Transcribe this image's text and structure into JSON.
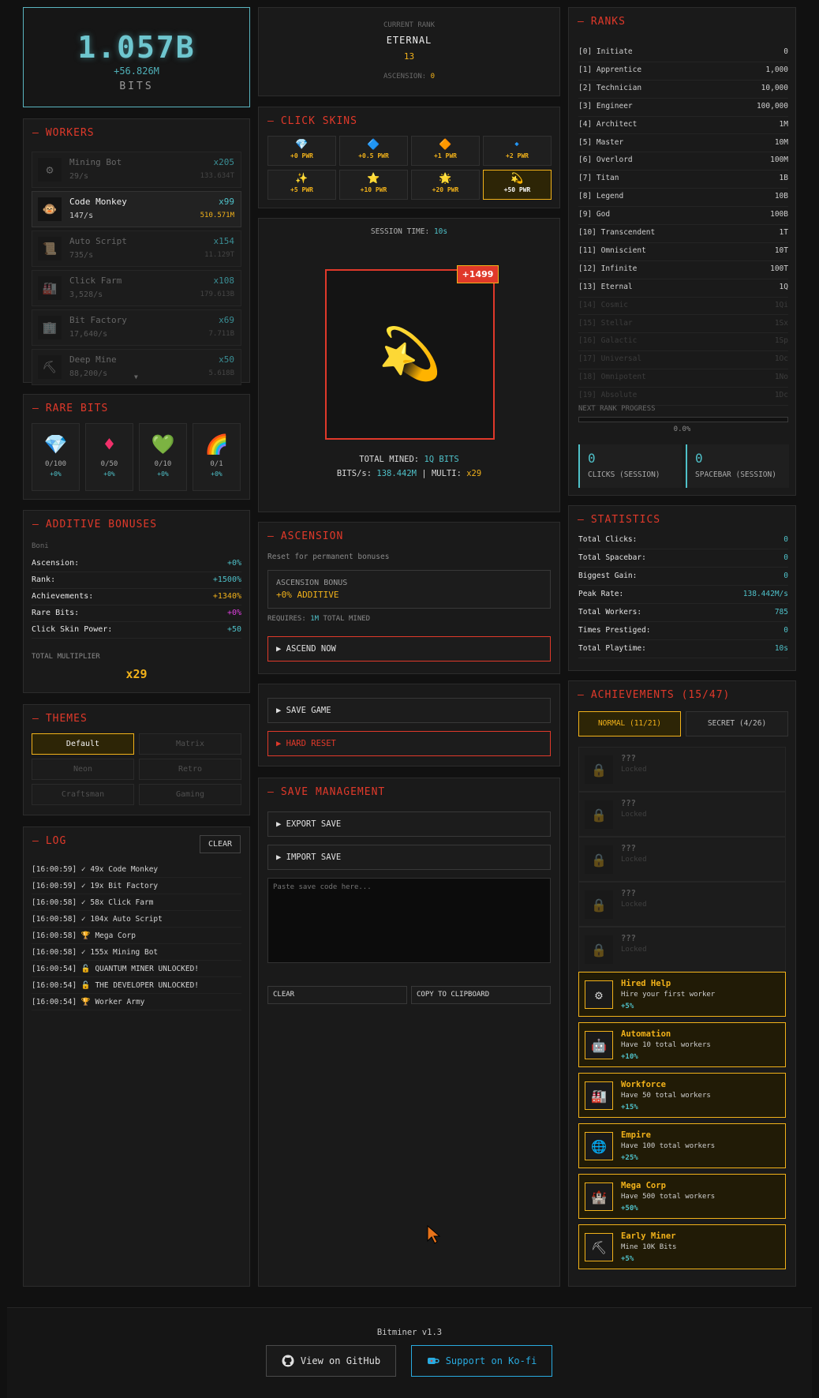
{
  "bits": {
    "value": "1.057B",
    "rate": "+56.826M",
    "unit": "BITS"
  },
  "workers": {
    "title": "WORKERS",
    "items": [
      {
        "name": "Mining Bot",
        "rate": "29/s",
        "count": "x205",
        "cost": "133.634T",
        "icon": "gear-icon",
        "glyph": "⚙",
        "active": false
      },
      {
        "name": "Code Monkey",
        "rate": "147/s",
        "count": "x99",
        "cost": "510.571M",
        "icon": "monkey-icon",
        "glyph": "🐵",
        "active": true
      },
      {
        "name": "Auto Script",
        "rate": "735/s",
        "count": "x154",
        "cost": "11.129T",
        "icon": "scroll-icon",
        "glyph": "📜",
        "active": false
      },
      {
        "name": "Click Farm",
        "rate": "3,528/s",
        "count": "x108",
        "cost": "179.613B",
        "icon": "factory-icon",
        "glyph": "🏭",
        "active": false
      },
      {
        "name": "Bit Factory",
        "rate": "17,640/s",
        "count": "x69",
        "cost": "7.711B",
        "icon": "building-icon",
        "glyph": "🏢",
        "active": false
      },
      {
        "name": "Deep Mine",
        "rate": "88,200/s",
        "count": "x50",
        "cost": "5.618B",
        "icon": "pickaxe-icon",
        "glyph": "⛏",
        "active": false
      }
    ],
    "scroll_glyph": "▼"
  },
  "rare_bits": {
    "title": "RARE BITS",
    "items": [
      {
        "icon": "diamond-icon",
        "glyph": "💎",
        "count": "0/100",
        "bonus": "+0%"
      },
      {
        "icon": "red-gem-icon",
        "glyph": "♦",
        "count": "0/50",
        "bonus": "+0%"
      },
      {
        "icon": "green-heart-icon",
        "glyph": "💚",
        "count": "0/10",
        "bonus": "+0%"
      },
      {
        "icon": "rainbow-icon",
        "glyph": "🌈",
        "count": "0/1",
        "bonus": "+0%"
      }
    ]
  },
  "additive": {
    "title": "ADDITIVE BONUSES",
    "subtitle": "Boni",
    "rows": [
      {
        "label": "Ascension:",
        "value": "+0%",
        "color": "#4fc1c9"
      },
      {
        "label": "Rank:",
        "value": "+1500%",
        "color": "#4fc1c9"
      },
      {
        "label": "Achievements:",
        "value": "+1340%",
        "color": "#f2b21a"
      },
      {
        "label": "Rare Bits:",
        "value": "+0%",
        "color": "#e040e0"
      },
      {
        "label": "Click Skin Power:",
        "value": "+50",
        "color": "#4fc1c9"
      }
    ],
    "total_label": "TOTAL MULTIPLIER",
    "total_value": "x29"
  },
  "themes": {
    "title": "THEMES",
    "items": [
      "Default",
      "Matrix",
      "Neon",
      "Retro",
      "Craftsman",
      "Gaming"
    ],
    "selected": "Default"
  },
  "log": {
    "title": "LOG",
    "clear_label": "CLEAR",
    "entries": [
      "[16:00:59] ✓ 49x Code Monkey",
      "[16:00:59] ✓ 19x Bit Factory",
      "[16:00:58] ✓ 58x Click Farm",
      "[16:00:58] ✓ 104x Auto Script",
      "[16:00:58] 🏆 Mega Corp",
      "[16:00:58] ✓ 155x Mining Bot",
      "[16:00:54] 🔓 QUANTUM MINER UNLOCKED!",
      "[16:00:54] 🔓 THE DEVELOPER UNLOCKED!",
      "[16:00:54] 🏆 Worker Army"
    ]
  },
  "rank": {
    "label": "CURRENT RANK",
    "name": "ETERNAL",
    "number": "13",
    "ascension_label": "ASCENSION:",
    "ascension_value": "0"
  },
  "skins": {
    "title": "CLICK SKINS",
    "items": [
      {
        "icon": "diamond-icon",
        "glyph": "💎",
        "power": "+0 PWR"
      },
      {
        "icon": "blue-diamond-icon",
        "glyph": "🔷",
        "power": "+0.5 PWR"
      },
      {
        "icon": "orange-diamond-icon",
        "glyph": "🔶",
        "power": "+1 PWR"
      },
      {
        "icon": "small-blue-diamond-icon",
        "glyph": "🔹",
        "power": "+2 PWR"
      },
      {
        "icon": "sparkles-icon",
        "glyph": "✨",
        "power": "+5 PWR"
      },
      {
        "icon": "star-icon",
        "glyph": "⭐",
        "power": "+10 PWR"
      },
      {
        "icon": "sun-icon",
        "glyph": "🌟",
        "power": "+20 PWR"
      },
      {
        "icon": "dizzy-icon",
        "glyph": "💫",
        "power": "+50 PWR"
      }
    ],
    "selected_index": 7
  },
  "click": {
    "session_label": "SESSION TIME:",
    "session_value": "10s",
    "gain": "+1499",
    "main_icon": "dizzy-icon",
    "main_glyph": "💫",
    "total_label": "TOTAL MINED:",
    "total_value": "1Q BITS",
    "rate_label": "BITS/s:",
    "rate_value": "138.442M",
    "multi_label": "| MULTI:",
    "multi_value": "x29"
  },
  "ascension": {
    "title": "ASCENSION",
    "subtitle": "Reset for permanent bonuses",
    "bonus_label": "ASCENSION BONUS",
    "bonus_value": "+0% ADDITIVE",
    "requires_label": "REQUIRES:",
    "requires_value": "1M",
    "requires_suffix": "TOTAL MINED",
    "button": "▶ ASCEND NOW"
  },
  "save": {
    "save_button": "▶ SAVE GAME",
    "reset_button": "▶ HARD RESET"
  },
  "save_management": {
    "title": "SAVE MANAGEMENT",
    "export_button": "▶ EXPORT SAVE",
    "import_button": "▶ IMPORT SAVE",
    "placeholder": "Paste save code here...",
    "clear_button": "CLEAR",
    "copy_button": "COPY TO CLIPBOARD"
  },
  "ranks": {
    "title": "RANKS",
    "items": [
      {
        "name": "[0] Initiate",
        "req": "0",
        "locked": false
      },
      {
        "name": "[1] Apprentice",
        "req": "1,000",
        "locked": false
      },
      {
        "name": "[2] Technician",
        "req": "10,000",
        "locked": false
      },
      {
        "name": "[3] Engineer",
        "req": "100,000",
        "locked": false
      },
      {
        "name": "[4] Architect",
        "req": "1M",
        "locked": false
      },
      {
        "name": "[5] Master",
        "req": "10M",
        "locked": false
      },
      {
        "name": "[6] Overlord",
        "req": "100M",
        "locked": false
      },
      {
        "name": "[7] Titan",
        "req": "1B",
        "locked": false
      },
      {
        "name": "[8] Legend",
        "req": "10B",
        "locked": false
      },
      {
        "name": "[9] God",
        "req": "100B",
        "locked": false
      },
      {
        "name": "[10] Transcendent",
        "req": "1T",
        "locked": false
      },
      {
        "name": "[11] Omniscient",
        "req": "10T",
        "locked": false
      },
      {
        "name": "[12] Infinite",
        "req": "100T",
        "locked": false
      },
      {
        "name": "[13] Eternal",
        "req": "1Q",
        "locked": false
      },
      {
        "name": "[14] Cosmic",
        "req": "1Qi",
        "locked": true
      },
      {
        "name": "[15] Stellar",
        "req": "1Sx",
        "locked": true
      },
      {
        "name": "[16] Galactic",
        "req": "1Sp",
        "locked": true
      },
      {
        "name": "[17] Universal",
        "req": "1Oc",
        "locked": true
      },
      {
        "name": "[18] Omnipotent",
        "req": "1No",
        "locked": true
      },
      {
        "name": "[19] Absolute",
        "req": "1Dc",
        "locked": true
      }
    ],
    "progress_label": "NEXT RANK PROGRESS",
    "progress_value": "0.0%",
    "progress_fraction": 0,
    "clicks_value": "0",
    "clicks_label": "CLICKS (SESSION)",
    "spacebar_value": "0",
    "spacebar_label": "SPACEBAR (SESSION)"
  },
  "statistics": {
    "title": "STATISTICS",
    "rows": [
      {
        "label": "Total Clicks:",
        "value": "0"
      },
      {
        "label": "Total Spacebar:",
        "value": "0"
      },
      {
        "label": "Biggest Gain:",
        "value": "0"
      },
      {
        "label": "Peak Rate:",
        "value": "138.442M/s"
      },
      {
        "label": "Total Workers:",
        "value": "785"
      },
      {
        "label": "Times Prestiged:",
        "value": "0"
      },
      {
        "label": "Total Playtime:",
        "value": "10s"
      }
    ]
  },
  "achievements": {
    "title": "ACHIEVEMENTS (15/47)",
    "tab_normal": "NORMAL (11/21)",
    "tab_secret": "SECRET (4/26)",
    "items": [
      {
        "name": "???",
        "desc": "Locked",
        "bonus": "",
        "icon": "lock-icon",
        "glyph": "🔒",
        "locked": true
      },
      {
        "name": "???",
        "desc": "Locked",
        "bonus": "",
        "icon": "lock-icon",
        "glyph": "🔒",
        "locked": true
      },
      {
        "name": "???",
        "desc": "Locked",
        "bonus": "",
        "icon": "lock-icon",
        "glyph": "🔒",
        "locked": true
      },
      {
        "name": "???",
        "desc": "Locked",
        "bonus": "",
        "icon": "lock-icon",
        "glyph": "🔒",
        "locked": true
      },
      {
        "name": "???",
        "desc": "Locked",
        "bonus": "",
        "icon": "lock-icon",
        "glyph": "🔒",
        "locked": true
      },
      {
        "name": "Hired Help",
        "desc": "Hire your first worker",
        "bonus": "+5%",
        "icon": "gear-icon",
        "glyph": "⚙",
        "locked": false
      },
      {
        "name": "Automation",
        "desc": "Have 10 total workers",
        "bonus": "+10%",
        "icon": "robot-icon",
        "glyph": "🤖",
        "locked": false
      },
      {
        "name": "Workforce",
        "desc": "Have 50 total workers",
        "bonus": "+15%",
        "icon": "factory-icon",
        "glyph": "🏭",
        "locked": false
      },
      {
        "name": "Empire",
        "desc": "Have 100 total workers",
        "bonus": "+25%",
        "icon": "globe-icon",
        "glyph": "🌐",
        "locked": false
      },
      {
        "name": "Mega Corp",
        "desc": "Have 500 total workers",
        "bonus": "+50%",
        "icon": "castle-icon",
        "glyph": "🏰",
        "locked": false
      },
      {
        "name": "Early Miner",
        "desc": "Mine 10K Bits",
        "bonus": "+5%",
        "icon": "pickaxe-icon",
        "glyph": "⛏",
        "locked": false
      }
    ]
  },
  "footer": {
    "version": "Bitminer v1.3",
    "github": "View on GitHub",
    "kofi": "Support on Ko-fi"
  }
}
